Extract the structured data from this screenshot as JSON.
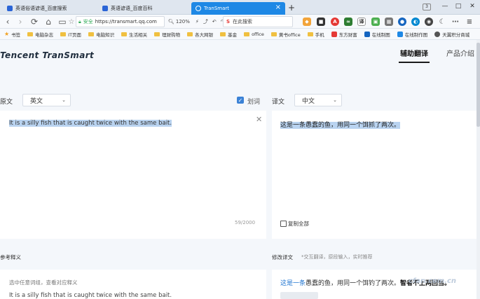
{
  "browser": {
    "tabs": [
      {
        "label": "英语俗语谚语_百度搜索",
        "favicon": "paw-icon",
        "color": "#2a64d6"
      },
      {
        "label": "英语谚语_百度百科",
        "favicon": "paw-icon",
        "color": "#2a64d6"
      },
      {
        "label": "TranSmart",
        "favicon": "globe-icon",
        "color": "#ffffff"
      }
    ],
    "new_tab": "+",
    "tab_count": "3",
    "window_buttons": [
      "—",
      "□",
      "✕"
    ],
    "nav": {
      "back": "‹",
      "forward": "›",
      "reload": "⟳",
      "home": "⌂",
      "reader": "▭",
      "star": "☆"
    },
    "url_secure_label": "安全",
    "url": "https://transmart.qq.com",
    "zoom": "120%",
    "search_placeholder": "在此搜索",
    "bookmarks": [
      {
        "label": "书签",
        "icon": "star-icon"
      },
      {
        "label": "电脑杂志",
        "icon": "folder-icon"
      },
      {
        "label": "IT页面",
        "icon": "folder-icon"
      },
      {
        "label": "电脑知识",
        "icon": "folder-icon"
      },
      {
        "label": "生活相关",
        "icon": "folder-icon"
      },
      {
        "label": "理财购物",
        "icon": "folder-icon"
      },
      {
        "label": "各大网银",
        "icon": "folder-icon"
      },
      {
        "label": "基金",
        "icon": "folder-icon"
      },
      {
        "label": "office",
        "icon": "folder-icon"
      },
      {
        "label": "黄书office",
        "icon": "folder-icon"
      },
      {
        "label": "手机",
        "icon": "folder-icon"
      },
      {
        "label": "东方财富",
        "icon": "site-icon"
      },
      {
        "label": "在线制图",
        "icon": "site-icon"
      },
      {
        "label": "在线制作图",
        "icon": "site-icon"
      },
      {
        "label": "天翼积分商城",
        "icon": "site-icon"
      }
    ]
  },
  "app": {
    "logo": "Tencent TranSmart",
    "nav": [
      {
        "label": "辅助翻译"
      },
      {
        "label": "产品介绍"
      }
    ],
    "source": {
      "label": "原文",
      "language": "英文",
      "word_select_label": "划词",
      "text": "It is a silly fish that is caught twice with the same bait.",
      "counter": "59/2000",
      "clear": "✕"
    },
    "target": {
      "label": "译文",
      "language": "中文",
      "text": "这是一条愚蠢的鱼，用同一个饵抓了两次。",
      "copy_label": "复制全部"
    },
    "reference": {
      "title": "参考释义",
      "prompt": "选中任意词组，查看对应释义",
      "text": "It is a silly fish that is caught twice with the same bait."
    },
    "edit": {
      "title": "修改译文",
      "hint": "*交互翻译，原段输入，实时推荐",
      "text_blue": "这是一条",
      "text_rest": "愚蠢的鱼，用同一个饵钓了两次。",
      "text_bold": "智者不上两回当。"
    },
    "watermark": "cfan.com.cn",
    "colors": {
      "accent": "#1e88e5",
      "highlight": "#b9d3f0",
      "check": "#3b82d6"
    }
  }
}
